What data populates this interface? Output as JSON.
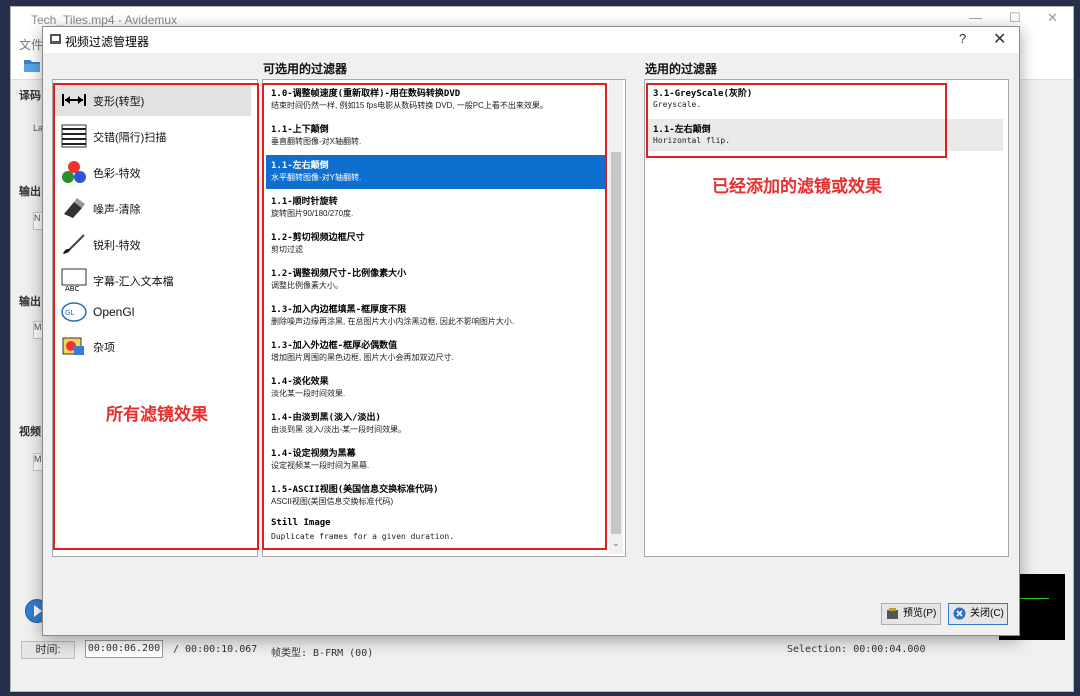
{
  "main_window": {
    "title": "Tech_Tiles.mp4 - Avidemux",
    "menu_file": "文件(",
    "controls": {
      "minimize": "—",
      "maximize": "☐",
      "close": "✕"
    },
    "side_labels": [
      "译码",
      "输出",
      "输出",
      "视频"
    ],
    "side_fragments": [
      "La",
      "N",
      "M",
      "M"
    ]
  },
  "status": {
    "time_label": "时间:",
    "current_time": "00:00:06.200",
    "total_time": "/ 00:00:10.067",
    "frame_type": "帧类型:  B-FRM (00)",
    "selection": "Selection: 00:00:04.000"
  },
  "dialog": {
    "title": "视频过滤管理器",
    "help": "?",
    "close": "✕",
    "available_title": "可选用的过滤器",
    "selected_title": "选用的过滤器",
    "categories": [
      {
        "label": "变形(转型)",
        "icon": "resize-arrows-icon",
        "active": true
      },
      {
        "label": "交错(隔行)扫描",
        "icon": "interlace-icon",
        "active": false
      },
      {
        "label": "色彩-特效",
        "icon": "color-balls-icon",
        "active": false
      },
      {
        "label": "噪声-清除",
        "icon": "eraser-icon",
        "active": false
      },
      {
        "label": "锐利-特效",
        "icon": "brush-icon",
        "active": false
      },
      {
        "label": "字幕-汇入文本檔",
        "icon": "subtitle-abc-icon",
        "active": false
      },
      {
        "label": "OpenGl",
        "icon": "opengl-icon",
        "active": false
      },
      {
        "label": "杂项",
        "icon": "misc-icon",
        "active": false
      }
    ],
    "filters": [
      {
        "name": "1.0-调整帧速度(重新取样)-用在数码转换DVD",
        "desc": "结束时间仍然一样, 例如15 fps电影从数码转换 DVD, 一般PC上看不出来效果。",
        "selected": false
      },
      {
        "name": "1.1-上下颠倒",
        "desc": "垂直翻转图像-对X轴翻转.",
        "selected": false
      },
      {
        "name": "1.1-左右颠倒",
        "desc": "水平翻转图像-对Y轴翻转.",
        "selected": true
      },
      {
        "name": "1.1-顺时针旋转",
        "desc": "旋转图片90/180/270度.",
        "selected": false
      },
      {
        "name": "1.2-剪切视频边框尺寸",
        "desc": "剪切过滤",
        "selected": false
      },
      {
        "name": "1.2-调整视频尺寸-比例像素大小",
        "desc": "调整比例像素大小。",
        "selected": false
      },
      {
        "name": "1.3-加入内边框填黑-框厚度不限",
        "desc": "删除噪声边缘再涂黑, 在总图片大小内涂黑边框, 因此不影响图片大小.",
        "selected": false
      },
      {
        "name": "1.3-加入外边框-框厚必偶数值",
        "desc": "增加图片周围的黑色边框, 图片大小会再加双边尺寸.",
        "selected": false
      },
      {
        "name": "1.4-淡化效果",
        "desc": "淡化某一段时间效果.",
        "selected": false
      },
      {
        "name": "1.4-由淡到黑(淡入/淡出)",
        "desc": "由淡到黑 淡入/淡出-某一段时间效果。",
        "selected": false
      },
      {
        "name": "1.4-设定视频为黑幕",
        "desc": "设定视频某一段时间为黑幕.",
        "selected": false
      },
      {
        "name": "1.5-ASCII视图(美国信息交换标准代码)",
        "desc": "ASCII视图(美国信息交换标准代码)",
        "selected": false
      },
      {
        "name": "Still Image",
        "desc": "Duplicate frames for a given duration.",
        "selected": false
      }
    ],
    "selected_filters": [
      {
        "name": "3.1-GreyScale(灰阶)",
        "desc": "Greyscale."
      },
      {
        "name": "1.1-左右颠倒",
        "desc": "Horizontal flip."
      }
    ],
    "buttons": {
      "preview": "预览(P)",
      "close": "关闭(C)"
    }
  },
  "annotations": {
    "all_filters": "所有滤镜效果",
    "added_filters": "已经添加的滤镜或效果",
    "color": "#e02020"
  },
  "colors": {
    "selection": "#0e6fcf",
    "desktop": "#26304a"
  }
}
